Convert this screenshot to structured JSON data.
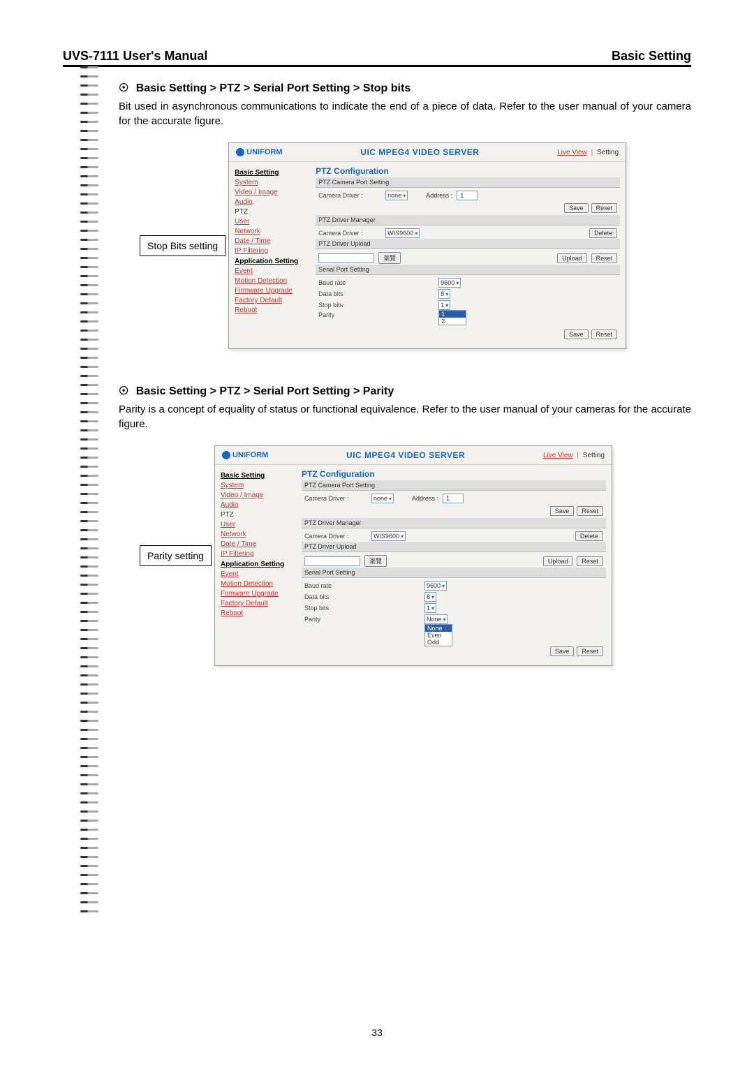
{
  "header": {
    "left": "UVS-7111 User's Manual",
    "right": "Basic Setting"
  },
  "section1": {
    "title": "Basic Setting > PTZ > Serial Port Setting > Stop bits",
    "desc": "Bit used in asynchronous communications to indicate the end of a piece of data. Refer to the user manual of your camera for the accurate figure.",
    "callout": "Stop Bits setting"
  },
  "section2": {
    "title": "Basic Setting > PTZ > Serial Port Setting > Parity",
    "desc": "Parity is a concept of equality of status or functional equivalence. Refer to the user manual of your cameras for the accurate figure.",
    "callout": "Parity setting"
  },
  "shot": {
    "logo": "UNIFORM",
    "title": "UIC MPEG4 VIDEO SERVER",
    "live_view": "Live View",
    "setting": "Setting",
    "nav": {
      "basic_setting": "Basic Setting",
      "system": "System",
      "video_image": "Video / Image",
      "audio": "Audio",
      "ptz": "PTZ",
      "user": "User",
      "network": "Network",
      "date_time": "Date / Time",
      "ip_filtering": "IP Filtering",
      "application_setting": "Application Setting",
      "event": "Event",
      "motion_detection": "Motion Detection",
      "firmware_upgrade": "Firmware Upgrade",
      "factory_default": "Factory Default",
      "reboot": "Reboot"
    },
    "main": {
      "ptz_config": "PTZ Configuration",
      "ptz_camera_port": "PTZ Camera Port Setting",
      "camera_driver": "Camera Driver :",
      "camera_driver_val": "none",
      "address": "Address :",
      "address_val": "1",
      "save": "Save",
      "reset": "Reset",
      "ptz_driver_manager": "PTZ Driver Manager",
      "ptz_driver_manager_val": "WIS9600",
      "delete": "Delete",
      "ptz_driver_upload": "PTZ Driver Upload",
      "browse": "瀏覽",
      "upload": "Upload",
      "serial_port_setting": "Serial Port Setting",
      "baud_rate": "Baud rate",
      "baud_rate_val": "9600",
      "data_bits": "Data bits",
      "data_bits_val": "8",
      "stop_bits": "Stop bits",
      "stop_bits_val": "1",
      "parity": "Parity",
      "parity_val": "None",
      "stopbits_options": {
        "hl": "1",
        "opt2": "2"
      },
      "parity_options": {
        "hl": "None",
        "opt2": "Even",
        "opt3": "Odd"
      }
    }
  },
  "page_num": "33"
}
